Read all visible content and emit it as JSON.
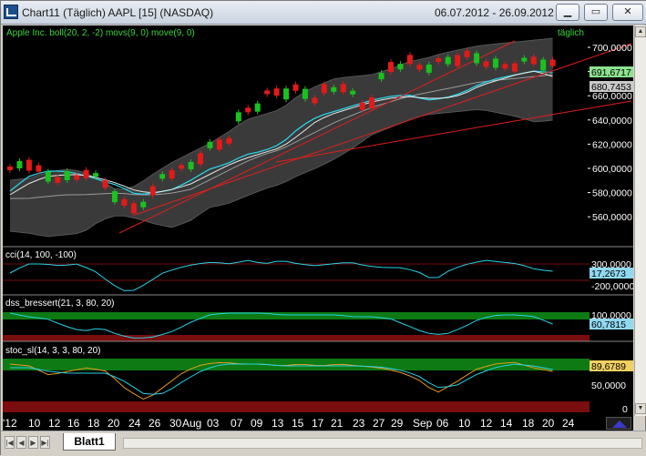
{
  "window": {
    "title": "Chart11 (Täglich)  AAPL [15] (NASDAQ)",
    "date_range": "06.07.2012 - 26.09.2012"
  },
  "panels": {
    "price": {
      "legend": "Apple Inc. boll(20, 2, -2) movs(9, 0) move(9, 0)",
      "period_label": "täglich",
      "last_value_1": "691,6717",
      "last_value_2": "680,7453",
      "y_ticks": [
        "700,0000",
        "680,0000",
        "660,0000",
        "640,0000",
        "620,0000",
        "600,0000",
        "580,0000",
        "560,0000"
      ]
    },
    "cci": {
      "legend": "cci(14, 100, -100)",
      "last_value": "17,2673",
      "y_ticks": [
        "300,0000",
        "-200,0000"
      ]
    },
    "dss": {
      "legend": "dss_bressert(21, 3, 80, 20)",
      "last_value": "60,7815",
      "y_ticks": [
        "100,0000"
      ]
    },
    "stoc": {
      "legend": "stoc_sl(14, 3, 3, 80, 20)",
      "last_value": "89,6789",
      "y_ticks": [
        "50,0000",
        "0"
      ]
    }
  },
  "x_axis": {
    "labels": [
      "'12",
      "10",
      "12",
      "16",
      "18",
      "20",
      "24",
      "26",
      "30",
      "Aug",
      "03",
      "07",
      "09",
      "13",
      "15",
      "17",
      "21",
      "23",
      "27",
      "29",
      "Sep",
      "06",
      "10",
      "12",
      "14",
      "18",
      "20",
      "24"
    ]
  },
  "colors": {
    "background": "#000000",
    "bull_candle": "#19c21f",
    "bear_candle": "#e21a1a",
    "band_fill": "#3a3a3a",
    "ma_cyan": "#27d3e6",
    "ma_white": "#e8e8e8",
    "channel_red": "#e11d1d",
    "overbought_green": "#0d7a14",
    "oversold_red": "#7a0d0d",
    "value_box_green": "#8de28f"
  },
  "sheet_tab": {
    "label": "Blatt1"
  },
  "icons": [
    "app-chart-icon",
    "minimize-icon",
    "restore-icon",
    "close-icon",
    "scroll-up-icon",
    "scroll-down-icon",
    "first-sheet-icon",
    "prev-sheet-icon",
    "next-sheet-icon",
    "last-sheet-icon"
  ]
}
